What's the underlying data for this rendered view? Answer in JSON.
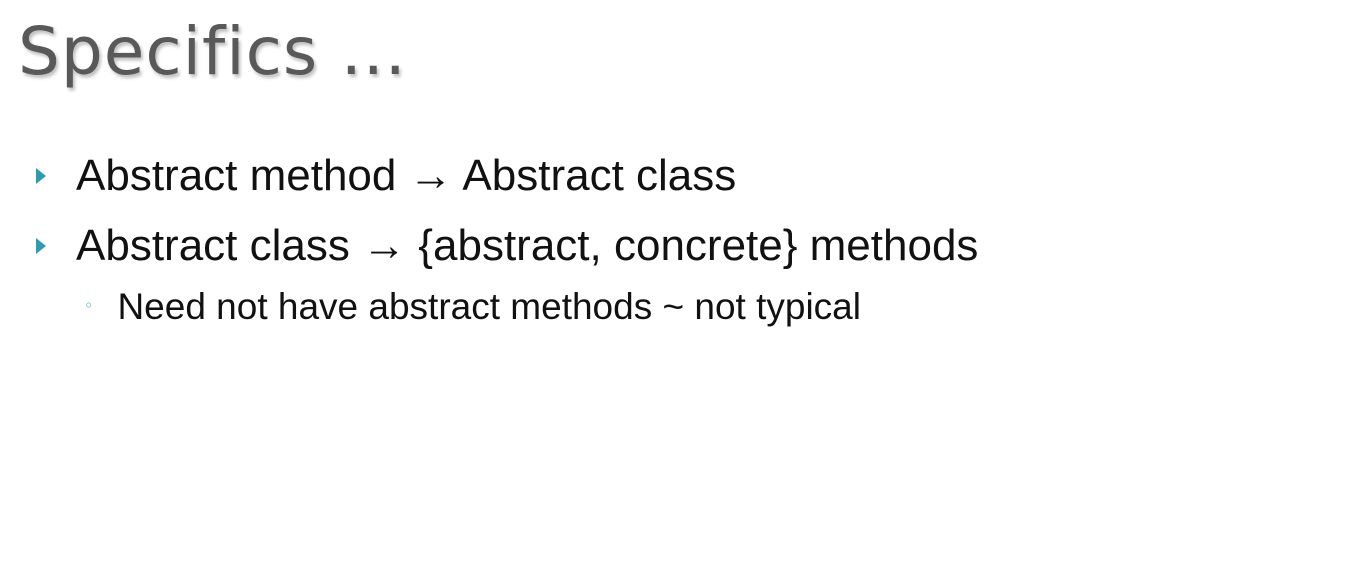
{
  "slide": {
    "title": "Specifics …",
    "bullets": [
      {
        "text": "Abstract method → Abstract class"
      },
      {
        "text": "Abstract class → {abstract, concrete} methods"
      }
    ],
    "sub_bullets": [
      {
        "text": "Need not have abstract methods ~ not typical",
        "marker": "◦"
      }
    ]
  },
  "colors": {
    "title": "#595959",
    "bullet_marker": "#2e9cb0",
    "body_text": "#111111",
    "background": "#ffffff"
  }
}
